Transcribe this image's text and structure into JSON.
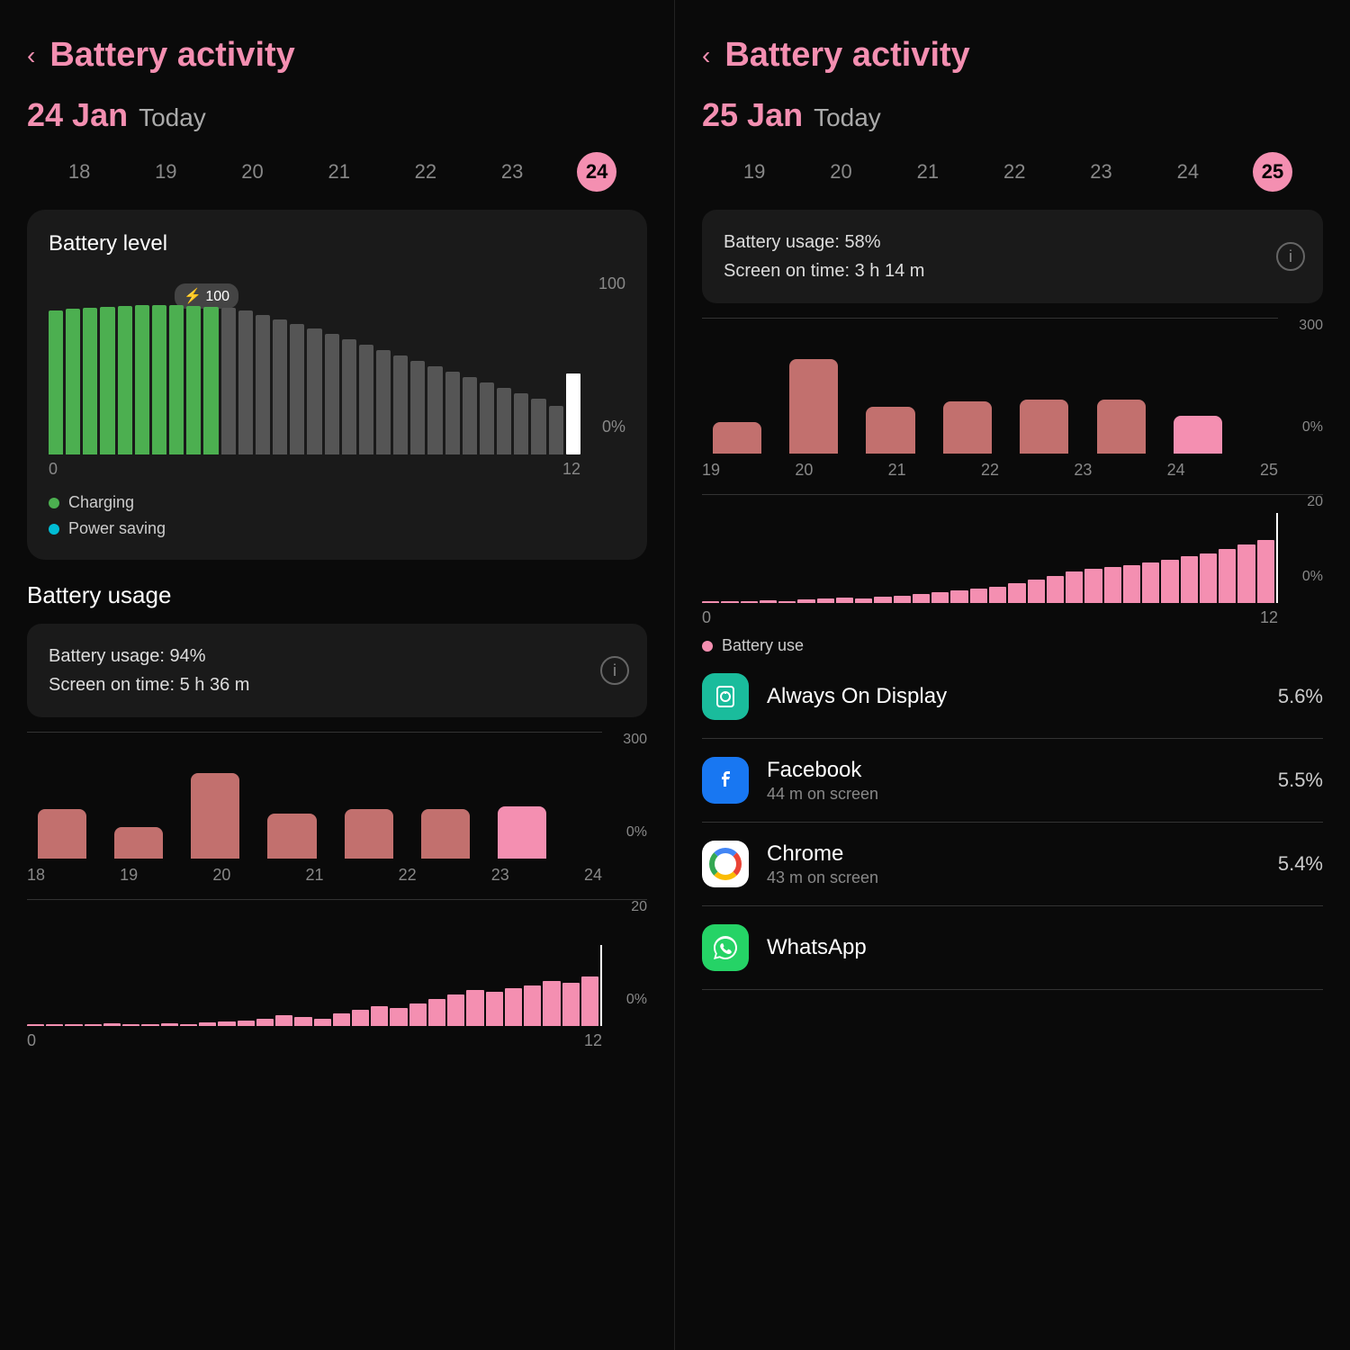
{
  "left": {
    "back_label": "‹",
    "title": "Battery activity",
    "date": "24 Jan",
    "date_qualifier": "Today",
    "days": [
      "18",
      "19",
      "20",
      "21",
      "22",
      "23",
      "24"
    ],
    "active_day": "24",
    "battery_section_title": "Battery level",
    "charging_badge": "⚡ 100",
    "battery_y_top": "100",
    "battery_y_bottom": "0%",
    "battery_x_left": "0",
    "battery_x_right": "12",
    "legend_charging": "Charging",
    "legend_power_saving": "Power saving",
    "usage_section_title": "Battery usage",
    "usage_pct": "Battery usage: 94%",
    "screen_time": "Screen on time: 5 h 36 m",
    "weekly_y_top": "300",
    "weekly_y_bottom": "0%",
    "weekly_days": [
      "18",
      "19",
      "20",
      "21",
      "22",
      "23",
      "24"
    ],
    "hourly_y_top": "20",
    "hourly_y_bottom": "0%",
    "hourly_x_left": "0",
    "hourly_x_right": "12"
  },
  "right": {
    "back_label": "‹",
    "title": "Battery activity",
    "date": "25 Jan",
    "date_qualifier": "Today",
    "days": [
      "19",
      "20",
      "21",
      "22",
      "23",
      "24",
      "25"
    ],
    "active_day": "25",
    "usage_pct": "Battery usage: 58%",
    "screen_time": "Screen on time: 3 h 14 m",
    "weekly_y_top": "300",
    "weekly_y_bottom": "0%",
    "weekly_days": [
      "19",
      "20",
      "21",
      "22",
      "23",
      "24",
      "25"
    ],
    "hourly_y_top": "20",
    "hourly_y_bottom": "0%",
    "hourly_x_left": "0",
    "hourly_x_right": "12",
    "battery_use_legend": "Battery use",
    "apps": [
      {
        "name": "Always On Display",
        "sub": "",
        "pct": "5.6%",
        "icon_type": "aod",
        "icon_char": "🕐"
      },
      {
        "name": "Facebook",
        "sub": "44 m on screen",
        "pct": "5.5%",
        "icon_type": "facebook",
        "icon_char": "f"
      },
      {
        "name": "Chrome",
        "sub": "43 m on screen",
        "pct": "5.4%",
        "icon_type": "chrome",
        "icon_char": ""
      },
      {
        "name": "WhatsApp",
        "sub": "",
        "pct": "",
        "icon_type": "whatsapp",
        "icon_char": "📱"
      }
    ]
  }
}
